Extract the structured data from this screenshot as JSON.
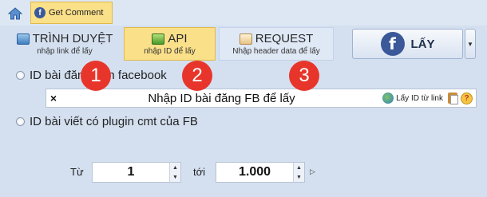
{
  "topbar": {
    "tab_label": "Get Comment"
  },
  "ribbon": {
    "browser": {
      "title": "TRÌNH DUYỆT",
      "subtitle": "nhập link để lấy"
    },
    "api": {
      "title": "API",
      "subtitle": "nhập ID để lấy"
    },
    "request": {
      "title": "REQUEST",
      "subtitle": "Nhập header data để lấy"
    },
    "lay_label": "LẤY"
  },
  "options": {
    "facebook_id_label": "ID bài đăng trên facebook",
    "plugin_label": "ID bài viết có plugin cmt của FB"
  },
  "idbox": {
    "clear": "×",
    "placeholder": "Nhập ID bài đăng FB để lấy",
    "link_label": "Lấy ID từ link"
  },
  "badges": [
    "1",
    "2",
    "3"
  ],
  "range": {
    "from_label": "Từ",
    "from_value": "1",
    "to_label": "tới",
    "to_value": "1.000"
  },
  "colors": {
    "badge": "#e8352b",
    "active_tab": "#fbe08a",
    "background": "#d4e0f0"
  }
}
